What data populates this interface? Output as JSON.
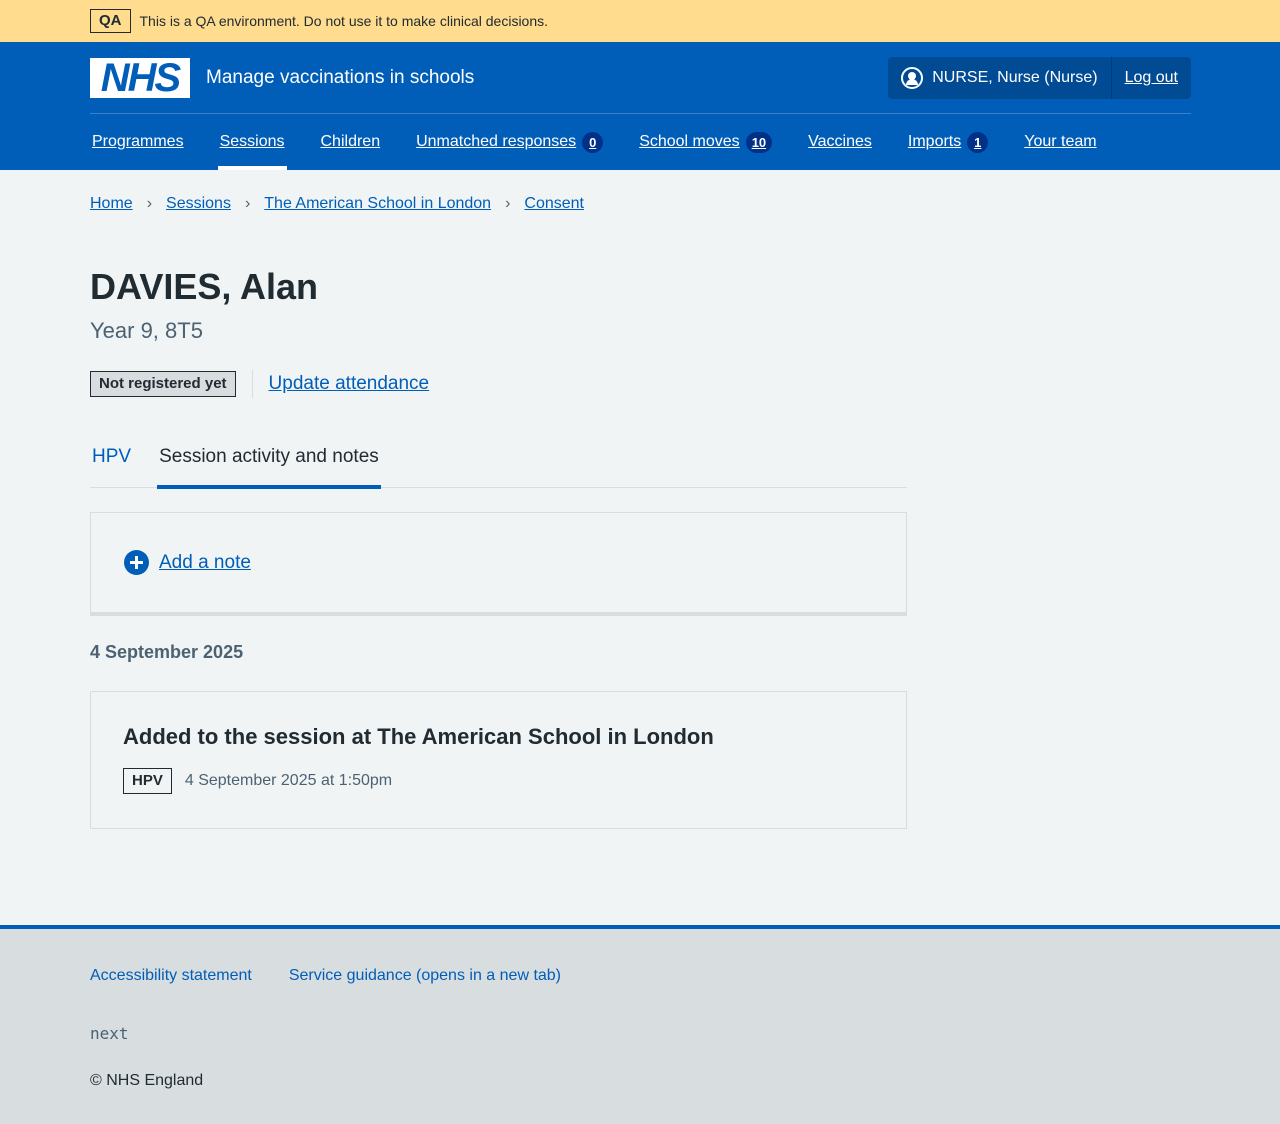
{
  "qa_banner": {
    "tag": "QA",
    "text": "This is a QA environment. Do not use it to make clinical decisions."
  },
  "header": {
    "logo_text": "NHS",
    "service_name": "Manage vaccinations in schools",
    "user": "NURSE, Nurse (Nurse)",
    "logout": "Log out"
  },
  "nav": {
    "programmes": "Programmes",
    "sessions": "Sessions",
    "children": "Children",
    "unmatched": "Unmatched responses",
    "unmatched_count": "0",
    "school_moves": "School moves",
    "school_moves_count": "10",
    "vaccines": "Vaccines",
    "imports": "Imports",
    "imports_count": "1",
    "your_team": "Your team"
  },
  "breadcrumb": {
    "home": "Home",
    "sessions": "Sessions",
    "school": "The American School in London",
    "consent": "Consent"
  },
  "patient": {
    "name": "DAVIES, Alan",
    "year_group": "Year 9, 8T5",
    "status": "Not registered yet",
    "update_attendance": "Update attendance"
  },
  "tabs": {
    "hpv": "HPV",
    "activity": "Session activity and notes"
  },
  "add_note": "Add a note",
  "activity": {
    "date": "4 September 2025",
    "event_title": "Added to the session at The American School in London",
    "event_tag": "HPV",
    "event_time": "4 September 2025 at 1:50pm"
  },
  "footer": {
    "accessibility": "Accessibility statement",
    "guidance": "Service guidance (opens in a new tab)",
    "version": "next",
    "copyright": "© NHS England"
  }
}
